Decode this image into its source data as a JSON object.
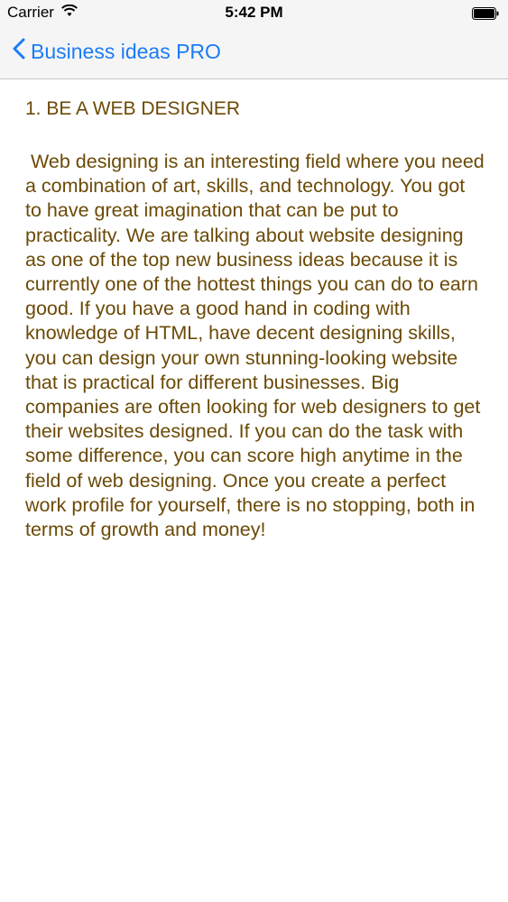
{
  "status_bar": {
    "carrier": "Carrier",
    "time": "5:42 PM",
    "wifi_icon": "wifi-icon",
    "battery_icon": "battery-icon"
  },
  "nav": {
    "back_label": "Business ideas PRO",
    "back_icon": "chevron-left-icon",
    "accent_color": "#1b7cf6"
  },
  "article": {
    "title": "1. BE A WEB DESIGNER",
    "body": " Web designing is an interesting field where you need a combination of art, skills, and technology. You got to have great imagination that can be put to practicality. We are talking about website designing as one of the top new business ideas because it is currently one of the hottest things you can do to earn good. If you have a good hand in coding with knowledge of HTML, have decent designing skills, you can design your own stunning-looking website that is practical for different businesses. Big companies are often looking for web designers to get their websites designed. If you can do the task with some difference, you can score high anytime in the field of web designing. Once you create a perfect work profile for yourself, there is no stopping, both in terms of growth and money!",
    "text_color": "#6b4a06"
  }
}
